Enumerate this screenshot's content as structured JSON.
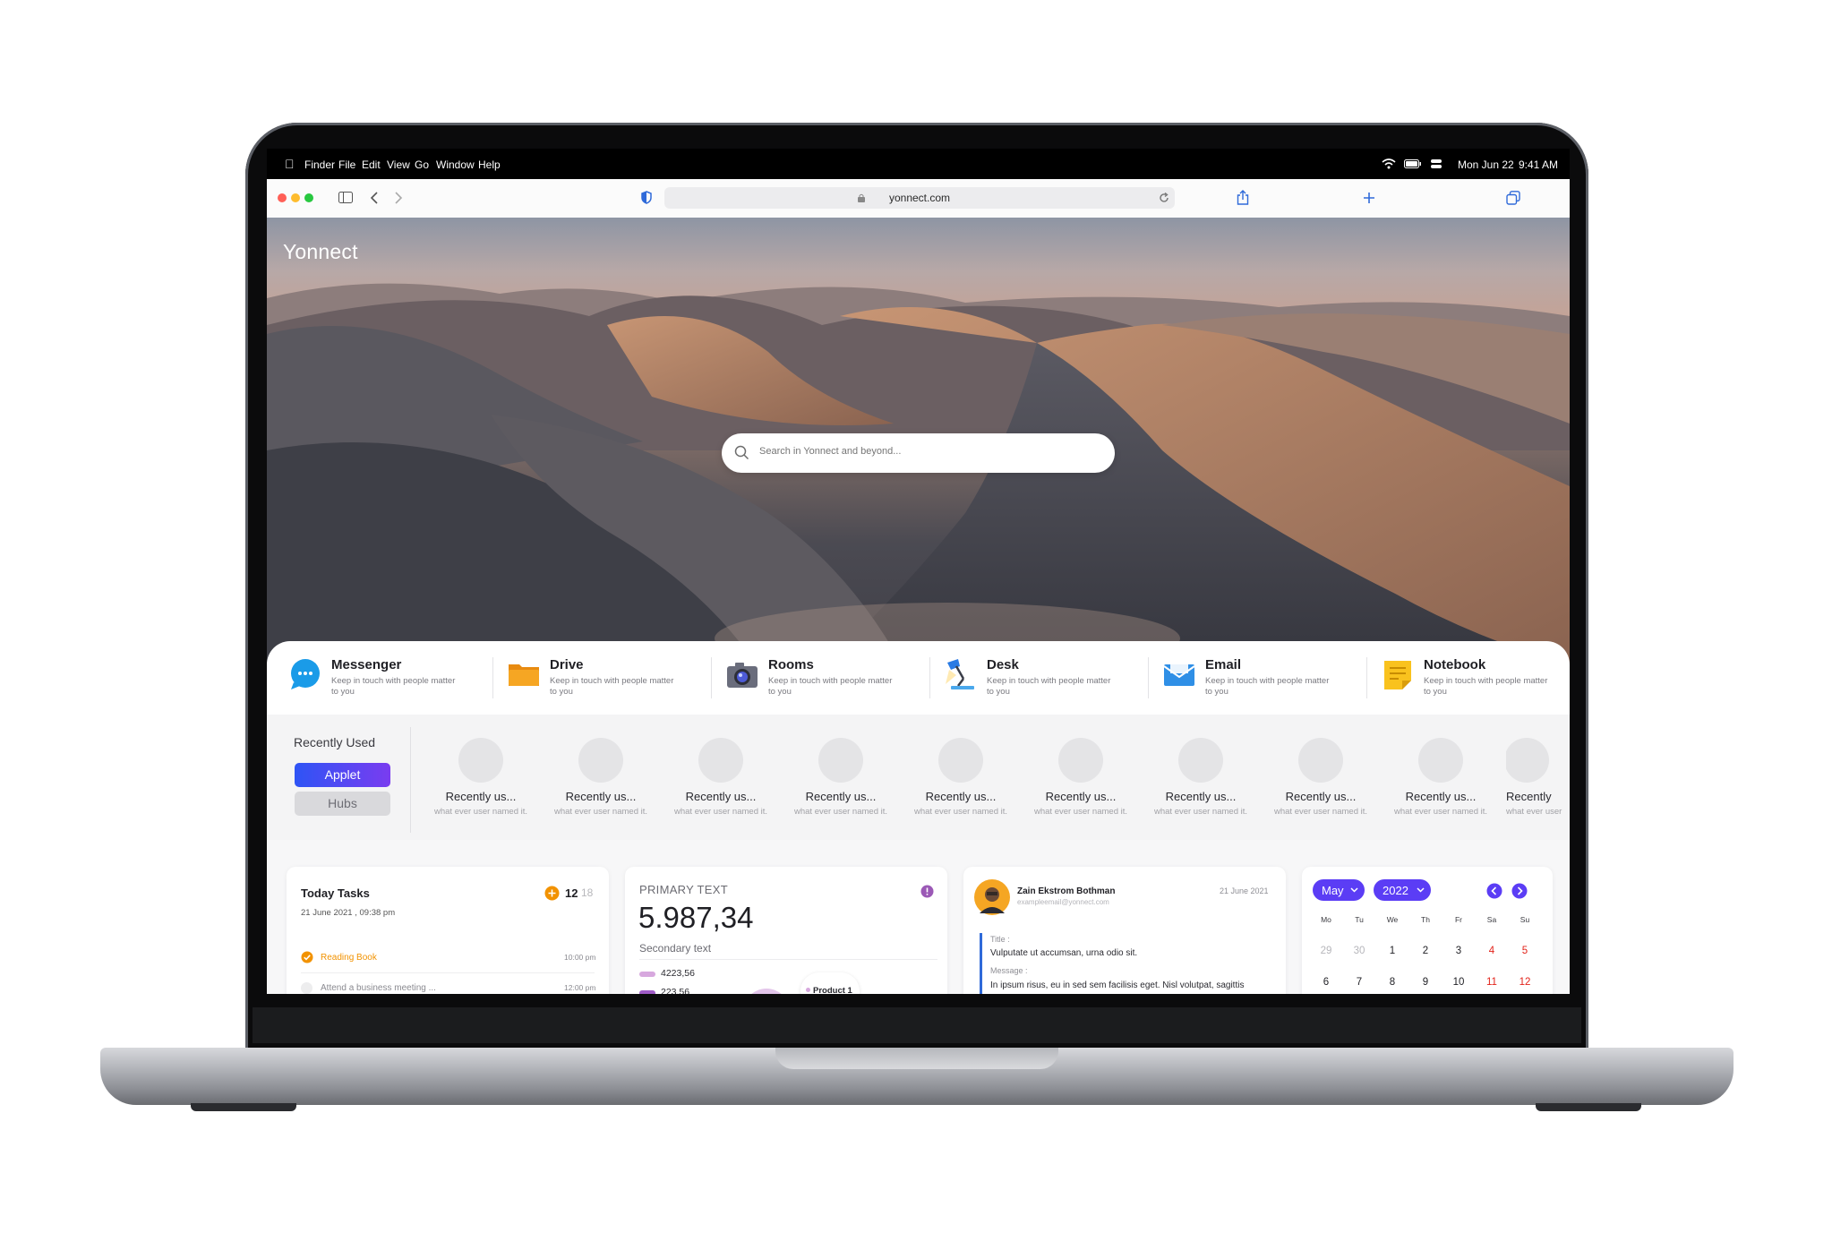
{
  "menubar": {
    "apple": "",
    "items": [
      "Finder",
      "File",
      "Edit",
      "View",
      "Go",
      "Window",
      "Help"
    ],
    "date": "Mon Jun 22",
    "time": "9:41 AM"
  },
  "browser": {
    "url": "yonnect.com"
  },
  "hero": {
    "brand": "Yonnect",
    "search_placeholder": "Search in Yonnect and beyond..."
  },
  "apps": [
    {
      "name": "Messenger",
      "desc": "Keep in touch with people matter to you",
      "icon": "messenger-icon"
    },
    {
      "name": "Drive",
      "desc": "Keep in touch with people matter to you",
      "icon": "folder-icon"
    },
    {
      "name": "Rooms",
      "desc": "Keep in touch with people matter to you",
      "icon": "camera-icon"
    },
    {
      "name": "Desk",
      "desc": "Keep in touch with people matter to you",
      "icon": "desk-lamp-icon"
    },
    {
      "name": "Email",
      "desc": "Keep in touch with people matter to you",
      "icon": "mail-icon"
    },
    {
      "name": "Notebook",
      "desc": "Keep in touch with people matter to you",
      "icon": "notebook-icon"
    }
  ],
  "recent": {
    "title": "Recently Used",
    "tabs": {
      "applet": "Applet",
      "hubs": "Hubs"
    },
    "items": [
      {
        "name": "Recently us...",
        "sub": "what ever user named it."
      },
      {
        "name": "Recently us...",
        "sub": "what ever user named it."
      },
      {
        "name": "Recently us...",
        "sub": "what ever user named it."
      },
      {
        "name": "Recently us...",
        "sub": "what ever user named it."
      },
      {
        "name": "Recently us...",
        "sub": "what ever user named it."
      },
      {
        "name": "Recently us...",
        "sub": "what ever user named it."
      },
      {
        "name": "Recently us...",
        "sub": "what ever user named it."
      },
      {
        "name": "Recently us...",
        "sub": "what ever user named it."
      },
      {
        "name": "Recently us...",
        "sub": "what ever user named it."
      },
      {
        "name": "Recently",
        "sub": "what ever user"
      }
    ]
  },
  "tasks": {
    "title": "Today Tasks",
    "date": "21 June 2021 , 09:38 pm",
    "done": "12",
    "total": "18",
    "items": [
      {
        "label": "Reading Book",
        "time": "10:00 pm",
        "done": true
      },
      {
        "label": "Attend a business meeting ...",
        "time": "12:00 pm",
        "done": false
      }
    ]
  },
  "primary": {
    "label": "PRIMARY TEXT",
    "value": "5.987,34",
    "secondary": "Secondary text",
    "legend": [
      {
        "value": "4223,56",
        "color": "#d7a8de"
      },
      {
        "value": "223,56",
        "color": "#a05cc7"
      }
    ],
    "product": "Product 1"
  },
  "mail": {
    "name": "Zain Ekstrom Bothman",
    "email": "exampleemail@yonnect.com",
    "date": "21 June 2021",
    "title_label": "Title :",
    "title": "Vulputate ut accumsan, urna odio sit.",
    "message_label": "Message :",
    "message": "In ipsum risus, eu in sed sem facilisis eget. Nisl volutpat, sagittis"
  },
  "calendar": {
    "month": "May",
    "year": "2022",
    "weekdays": [
      "Mo",
      "Tu",
      "We",
      "Th",
      "Fr",
      "Sa",
      "Su"
    ],
    "row1": [
      "29",
      "30",
      "1",
      "2",
      "3",
      "4",
      "5"
    ],
    "row2": [
      "6",
      "7",
      "8",
      "9",
      "10",
      "11",
      "12"
    ]
  },
  "colors": {
    "accent": "#5b3df5",
    "orange": "#f29200",
    "weekend": "#e2231a"
  }
}
